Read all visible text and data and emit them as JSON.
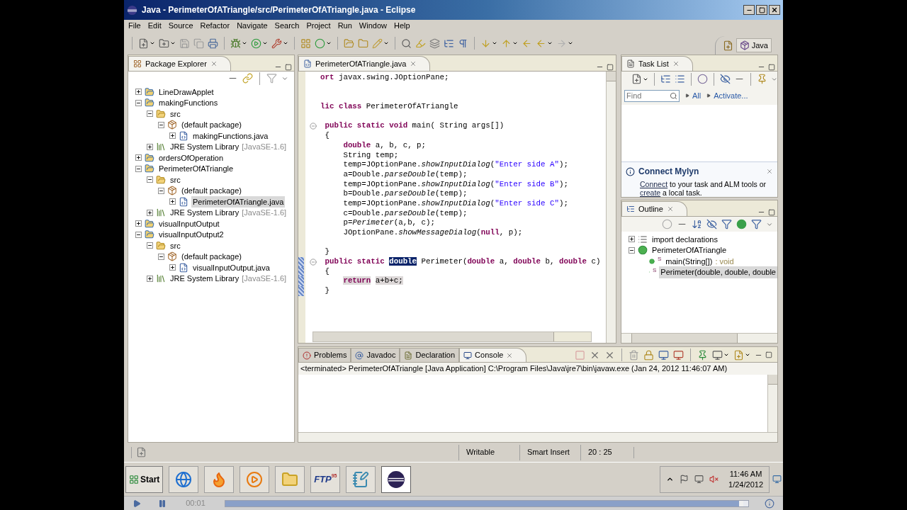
{
  "window": {
    "title": "Java - PerimeterOfATriangle/src/PerimeterOfATriangle.java - Eclipse"
  },
  "menu": [
    "File",
    "Edit",
    "Source",
    "Refactor",
    "Navigate",
    "Search",
    "Project",
    "Run",
    "Window",
    "Help"
  ],
  "perspective": {
    "label": "Java",
    "selected": true
  },
  "package_explorer": {
    "title": "Package Explorer",
    "tree": [
      {
        "label": "LineDrawApplet",
        "kind": "project",
        "expanded": false,
        "selected": false
      },
      {
        "label": "makingFunctions",
        "kind": "project",
        "expanded": true,
        "selected": false,
        "children": [
          {
            "label": "src",
            "kind": "folder",
            "expanded": true,
            "selected": false,
            "children": [
              {
                "label": "(default package)",
                "kind": "package",
                "expanded": true,
                "selected": false,
                "children": [
                  {
                    "label": "makingFunctions.java",
                    "kind": "file",
                    "expanded": false,
                    "selected": false
                  }
                ]
              }
            ]
          },
          {
            "label": "JRE System Library",
            "detail": "[JavaSE-1.6]",
            "kind": "library",
            "expanded": false,
            "selected": false
          }
        ]
      },
      {
        "label": "ordersOfOperation",
        "kind": "project",
        "expanded": false,
        "selected": false
      },
      {
        "label": "PerimeterOfATriangle",
        "kind": "project",
        "expanded": true,
        "selected": false,
        "children": [
          {
            "label": "src",
            "kind": "folder",
            "expanded": true,
            "selected": false,
            "children": [
              {
                "label": "(default package)",
                "kind": "package",
                "expanded": true,
                "selected": false,
                "children": [
                  {
                    "label": "PerimeterOfATriangle.java",
                    "kind": "file",
                    "expanded": false,
                    "selected": true
                  }
                ]
              }
            ]
          },
          {
            "label": "JRE System Library",
            "detail": "[JavaSE-1.6]",
            "kind": "library",
            "expanded": false,
            "selected": false
          }
        ]
      },
      {
        "label": "visualInputOutput",
        "kind": "project",
        "expanded": false,
        "selected": false
      },
      {
        "label": "visualInputOutput2",
        "kind": "project",
        "expanded": true,
        "selected": false,
        "children": [
          {
            "label": "src",
            "kind": "folder",
            "expanded": true,
            "selected": false,
            "children": [
              {
                "label": "(default package)",
                "kind": "package",
                "expanded": true,
                "selected": false,
                "children": [
                  {
                    "label": "visualInputOutput.java",
                    "kind": "file",
                    "expanded": false,
                    "selected": false
                  }
                ]
              }
            ]
          },
          {
            "label": "JRE System Library",
            "detail": "[JavaSE-1.6]",
            "kind": "library",
            "expanded": false,
            "selected": false
          }
        ]
      }
    ]
  },
  "editor": {
    "tab": {
      "label": "PerimeterOfATriangle.java",
      "selected": true
    },
    "lines": [
      {
        "kind": "code",
        "fold": false,
        "in_range": false,
        "segments": [
          {
            "text": "ort",
            "kind": "keyword"
          },
          {
            "text": " javax.swing.JOptionPane;",
            "kind": "plain"
          }
        ]
      },
      {
        "kind": "blank"
      },
      {
        "kind": "blank"
      },
      {
        "kind": "code",
        "fold": false,
        "in_range": false,
        "segments": [
          {
            "text": "lic class",
            "kind": "keyword"
          },
          {
            "text": " PerimeterOfATriangle",
            "kind": "plain"
          }
        ]
      },
      {
        "kind": "blank"
      },
      {
        "kind": "code",
        "fold": true,
        "in_range": false,
        "segments": [
          {
            "text": " public static void",
            "kind": "keyword"
          },
          {
            "text": " main( String args[])",
            "kind": "plain"
          }
        ]
      },
      {
        "kind": "code",
        "fold": false,
        "in_range": false,
        "segments": [
          {
            "text": " {",
            "kind": "plain"
          }
        ]
      },
      {
        "kind": "code",
        "fold": false,
        "in_range": false,
        "segments": [
          {
            "text": "     double",
            "kind": "keyword"
          },
          {
            "text": " a, b, c, p;",
            "kind": "plain"
          }
        ]
      },
      {
        "kind": "code",
        "fold": false,
        "in_range": false,
        "segments": [
          {
            "text": "     String temp;",
            "kind": "plain"
          }
        ]
      },
      {
        "kind": "code",
        "fold": false,
        "in_range": false,
        "segments": [
          {
            "text": "     temp=JOptionPane.",
            "kind": "plain"
          },
          {
            "text": "showInputDialog",
            "kind": "static"
          },
          {
            "text": "(",
            "kind": "plain"
          },
          {
            "text": "\"Enter side A\"",
            "kind": "string"
          },
          {
            "text": ");",
            "kind": "plain"
          }
        ]
      },
      {
        "kind": "code",
        "fold": false,
        "in_range": false,
        "segments": [
          {
            "text": "     a=Double.",
            "kind": "plain"
          },
          {
            "text": "parseDouble",
            "kind": "static"
          },
          {
            "text": "(temp);",
            "kind": "plain"
          }
        ]
      },
      {
        "kind": "code",
        "fold": false,
        "in_range": false,
        "segments": [
          {
            "text": "     temp=JOptionPane.",
            "kind": "plain"
          },
          {
            "text": "showInputDialog",
            "kind": "static"
          },
          {
            "text": "(",
            "kind": "plain"
          },
          {
            "text": "\"Enter side B\"",
            "kind": "string"
          },
          {
            "text": ");",
            "kind": "plain"
          }
        ]
      },
      {
        "kind": "code",
        "fold": false,
        "in_range": false,
        "segments": [
          {
            "text": "     b=Double.",
            "kind": "plain"
          },
          {
            "text": "parseDouble",
            "kind": "static"
          },
          {
            "text": "(temp);",
            "kind": "plain"
          }
        ]
      },
      {
        "kind": "code",
        "fold": false,
        "in_range": false,
        "segments": [
          {
            "text": "     temp=JOptionPane.",
            "kind": "plain"
          },
          {
            "text": "showInputDialog",
            "kind": "static"
          },
          {
            "text": "(",
            "kind": "plain"
          },
          {
            "text": "\"Enter side C\"",
            "kind": "string"
          },
          {
            "text": ");",
            "kind": "plain"
          }
        ]
      },
      {
        "kind": "code",
        "fold": false,
        "in_range": false,
        "segments": [
          {
            "text": "     c=Double.",
            "kind": "plain"
          },
          {
            "text": "parseDouble",
            "kind": "static"
          },
          {
            "text": "(temp);",
            "kind": "plain"
          }
        ]
      },
      {
        "kind": "code",
        "fold": false,
        "in_range": false,
        "segments": [
          {
            "text": "     p=",
            "kind": "plain"
          },
          {
            "text": "Perimeter",
            "kind": "static"
          },
          {
            "text": "(a,b, c);",
            "kind": "plain"
          }
        ]
      },
      {
        "kind": "code",
        "fold": false,
        "in_range": false,
        "segments": [
          {
            "text": "     JOptionPane.",
            "kind": "plain"
          },
          {
            "text": "showMessageDialog",
            "kind": "static"
          },
          {
            "text": "(",
            "kind": "plain"
          },
          {
            "text": "null",
            "kind": "keyword"
          },
          {
            "text": ", p);",
            "kind": "plain"
          }
        ]
      },
      {
        "kind": "blank"
      },
      {
        "kind": "code",
        "fold": false,
        "in_range": false,
        "segments": [
          {
            "text": " }",
            "kind": "plain"
          }
        ]
      },
      {
        "kind": "code",
        "fold": true,
        "in_range": true,
        "segments": [
          {
            "text": " public static ",
            "kind": "keyword"
          },
          {
            "text": "double",
            "kind": "selected"
          },
          {
            "text": " Perimeter(",
            "kind": "plain"
          },
          {
            "text": "double",
            "kind": "keyword"
          },
          {
            "text": " a, ",
            "kind": "plain"
          },
          {
            "text": "double",
            "kind": "keyword"
          },
          {
            "text": " b, ",
            "kind": "plain"
          },
          {
            "text": "double",
            "kind": "keyword"
          },
          {
            "text": " c)",
            "kind": "plain"
          }
        ]
      },
      {
        "kind": "code",
        "fold": false,
        "in_range": true,
        "segments": [
          {
            "text": " {",
            "kind": "plain"
          }
        ]
      },
      {
        "kind": "code",
        "fold": false,
        "in_range": true,
        "segments": [
          {
            "text": "     return",
            "kind": "keyword_marked"
          },
          {
            "text": " a+b+c;",
            "kind": "plain_marked"
          }
        ]
      },
      {
        "kind": "code",
        "fold": false,
        "in_range": true,
        "segments": [
          {
            "text": " }",
            "kind": "plain"
          }
        ]
      }
    ]
  },
  "task_list": {
    "title": "Task List",
    "find": {
      "placeholder": "Find"
    },
    "links": [
      "All",
      "Activate..."
    ],
    "mylyn": {
      "title": "Connect Mylyn",
      "message": [
        {
          "text": "Connect",
          "kind": "link"
        },
        {
          "text": " to your task and ALM tools or ",
          "kind": "text"
        },
        {
          "text": "create",
          "kind": "link"
        },
        {
          "text": " a local task.",
          "kind": "text"
        }
      ]
    }
  },
  "outline": {
    "title": "Outline",
    "tree": [
      {
        "label": "import declarations",
        "kind": "imports",
        "expanded": false,
        "selected": false
      },
      {
        "label": "PerimeterOfATriangle",
        "kind": "class",
        "expanded": true,
        "selected": false,
        "children": [
          {
            "label": "main(String[])",
            "detail": ": void",
            "kind": "method",
            "badge": "S",
            "selected": false
          },
          {
            "label": "Perimeter(double, double, double",
            "kind": "method",
            "badge": "S",
            "selected": true
          }
        ]
      }
    ]
  },
  "console": {
    "tabs": [
      {
        "label": "Problems",
        "kind": "problems",
        "selected": false
      },
      {
        "label": "Javadoc",
        "kind": "javadoc",
        "selected": false
      },
      {
        "label": "Declaration",
        "kind": "declaration",
        "selected": false
      },
      {
        "label": "Console",
        "kind": "console",
        "selected": true
      }
    ],
    "header": "<terminated> PerimeterOfATriangle [Java Application] C:\\Program Files\\Java\\jre7\\bin\\javaw.exe (Jan 24, 2012 11:46:07 AM)"
  },
  "status_bar": [
    "Writable",
    "Smart Insert",
    "20 : 25"
  ],
  "taskbar": {
    "start": "Start",
    "apps": [
      {
        "kind": "ie",
        "selected": false
      },
      {
        "kind": "firefox",
        "selected": false
      },
      {
        "kind": "media",
        "selected": false
      },
      {
        "kind": "explorer",
        "selected": false
      },
      {
        "kind": "ftp",
        "label": "FTP",
        "badge": "95",
        "selected": false
      },
      {
        "kind": "notepad",
        "selected": false
      },
      {
        "kind": "eclipse",
        "selected": true
      }
    ],
    "time": "11:46 AM",
    "date": "1/24/2012"
  },
  "player": {
    "time": "00:01",
    "level": 0.99
  }
}
